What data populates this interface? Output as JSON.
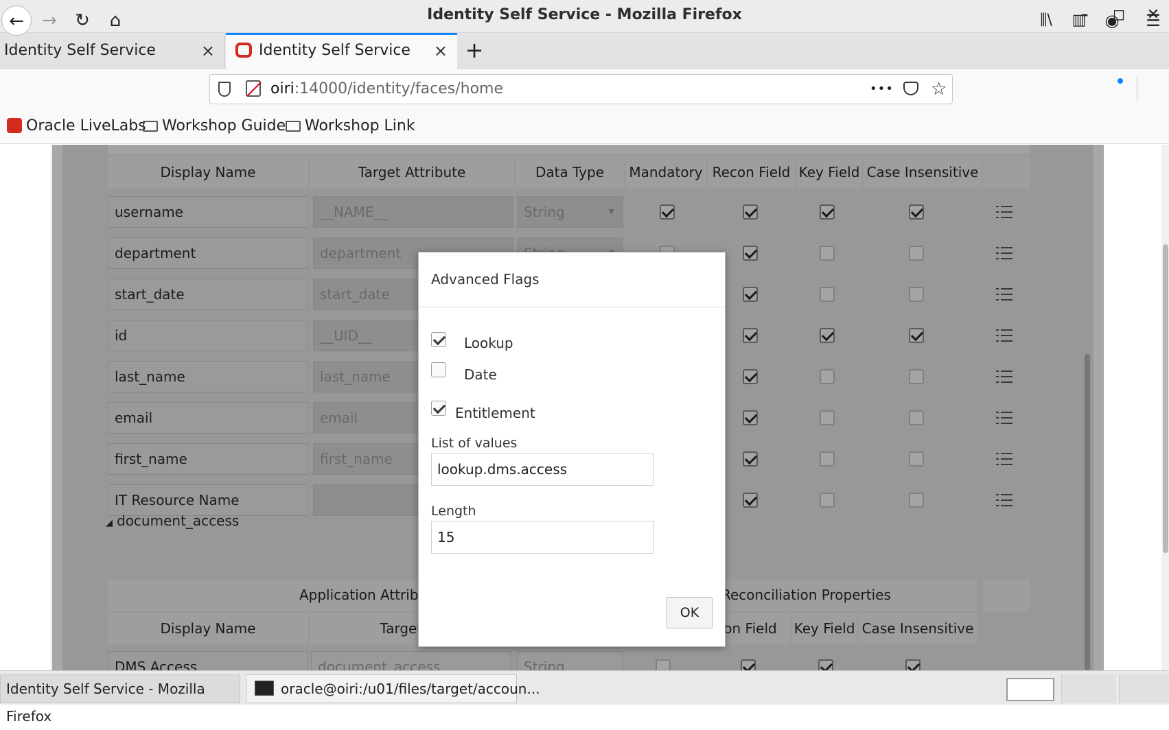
{
  "window": {
    "title": "Identity Self Service - Mozilla Firefox",
    "minimize": "–",
    "maximize": "◻",
    "close": "✕"
  },
  "tabs": [
    {
      "label": "Identity Self Service",
      "close": "×"
    },
    {
      "label": "Identity Self Service",
      "close": "×"
    }
  ],
  "new_tab": "+",
  "nav": {
    "back": "←",
    "forward": "→",
    "reload": "↻",
    "home": "⌂",
    "url_host": "oiri",
    "url_rest": ":14000/identity/faces/home",
    "more": "•••",
    "pocket": "◡",
    "bookmark_star": "☆",
    "library": "⫼\\",
    "sidebar": "▥",
    "account": "◉",
    "menu": "☰"
  },
  "bookmarks": [
    {
      "label": "Oracle LiveLabs",
      "icon": "livelabs-icon"
    },
    {
      "label": "Workshop Guide",
      "icon": "folder-icon"
    },
    {
      "label": "Workshop Link",
      "icon": "folder-icon"
    }
  ],
  "table1": {
    "headers": [
      "Display Name",
      "Target Attribute",
      "Data Type",
      "Mandatory",
      "Recon Field",
      "Key Field",
      "Case Insensitive"
    ],
    "rows": [
      {
        "display": "username",
        "target": "__NAME__",
        "type": "String",
        "mandatory": true,
        "recon": true,
        "key": true,
        "case": true
      },
      {
        "display": "department",
        "target": "department",
        "type": "String",
        "mandatory": false,
        "recon": true,
        "key": false,
        "case": false
      },
      {
        "display": "start_date",
        "target": "start_date",
        "type": "",
        "mandatory": false,
        "recon": true,
        "key": false,
        "case": false
      },
      {
        "display": "id",
        "target": "__UID__",
        "type": "",
        "mandatory": false,
        "recon": true,
        "key": true,
        "case": true
      },
      {
        "display": "last_name",
        "target": "last_name",
        "type": "",
        "mandatory": false,
        "recon": true,
        "key": false,
        "case": false
      },
      {
        "display": "email",
        "target": "email",
        "type": "",
        "mandatory": false,
        "recon": true,
        "key": false,
        "case": false
      },
      {
        "display": "first_name",
        "target": "first_name",
        "type": "",
        "mandatory": false,
        "recon": true,
        "key": false,
        "case": false
      },
      {
        "display": "IT Resource Name",
        "target": "",
        "type": "",
        "mandatory": false,
        "recon": true,
        "key": false,
        "case": false
      }
    ]
  },
  "section2": {
    "title": "document_access",
    "group_app": "Application Attribut",
    "group_recon": "Reconciliation Properties",
    "headers": [
      "Display Name",
      "Target At",
      "con Field",
      "Key Field",
      "Case Insensitive"
    ],
    "row": {
      "display": "DMS Access",
      "target": "document_access",
      "type": "String"
    }
  },
  "dialog": {
    "title": "Advanced Flags",
    "lookup": {
      "label": "Lookup",
      "checked": true
    },
    "date": {
      "label": "Date",
      "checked": false
    },
    "entitlement": {
      "label": "Entitlement",
      "checked": true
    },
    "lov_label": "List of values",
    "lov_value": "lookup.dms.access",
    "length_label": "Length",
    "length_value": "15",
    "ok": "OK"
  },
  "taskbar": [
    {
      "label": "Identity Self Service - Mozilla Firefox"
    },
    {
      "label": "oracle@oiri:/u01/files/target/accoun..."
    }
  ]
}
